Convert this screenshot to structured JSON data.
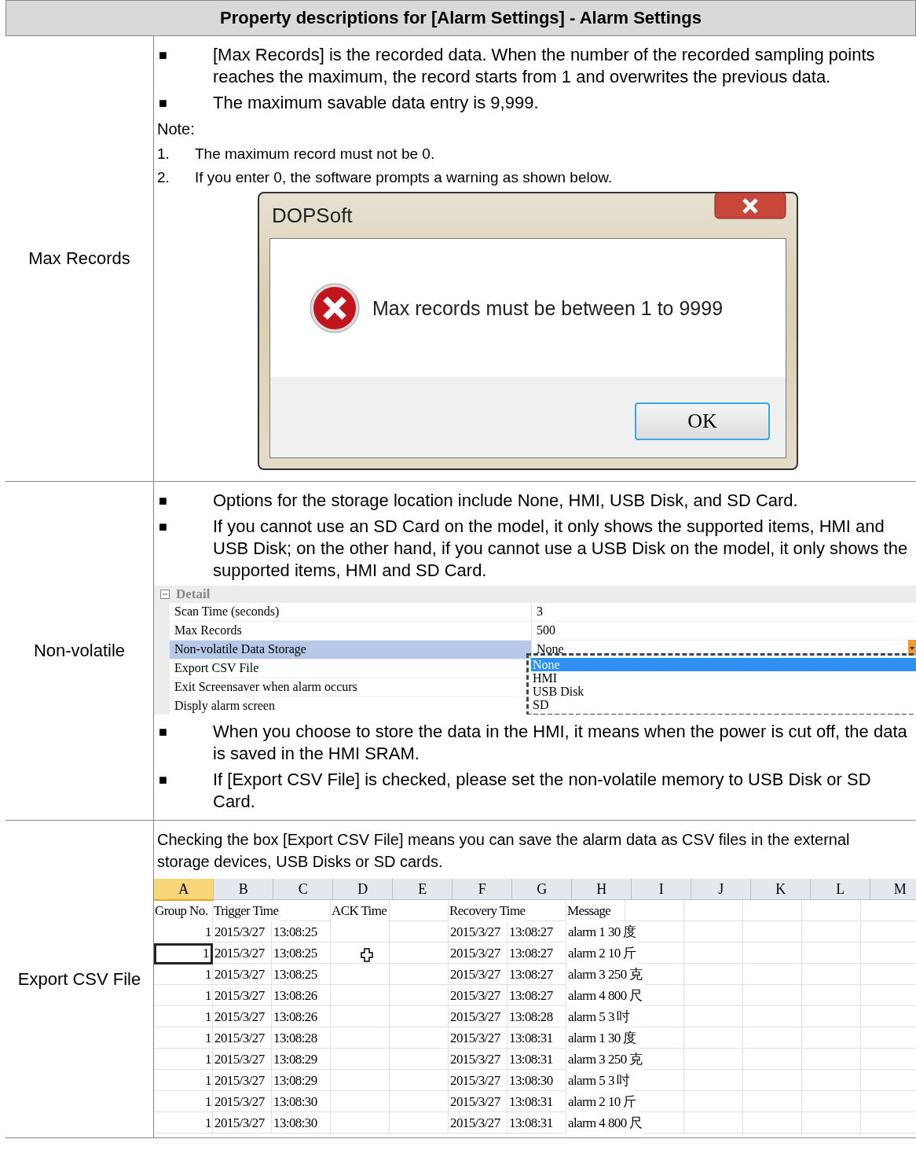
{
  "title": "Property descriptions for [Alarm Settings] - Alarm Settings",
  "sections": [
    {
      "label": "Max Records",
      "blocks": [
        {
          "kind": "bullet",
          "marker": "■",
          "text": "[Max Records] is the recorded data. When the number of the recorded sampling points reaches the maximum, the record starts from 1 and overwrites the previous data."
        },
        {
          "kind": "bullet",
          "marker": "■",
          "text": "The maximum savable data entry is 9,999."
        },
        {
          "kind": "para",
          "text": "Note:"
        },
        {
          "kind": "numbered",
          "marker": "1.",
          "text": "The maximum record must not be 0."
        },
        {
          "kind": "numbered",
          "marker": "2.",
          "text": "If you enter 0, the software prompts a warning as shown below."
        },
        {
          "kind": "dialog",
          "title": "DOPSoft",
          "message": "Max records must be between 1 to 9999",
          "button": "OK"
        }
      ]
    },
    {
      "label": "Non-volatile",
      "blocks": [
        {
          "kind": "bullet",
          "marker": "■",
          "text": "Options for the storage location include None, HMI, USB Disk, and SD Card."
        },
        {
          "kind": "bullet",
          "marker": "■",
          "text": "If you cannot use an SD Card on the model, it only shows the supported items, HMI and USB Disk; on the other hand, if you cannot use a USB Disk on the model, it only shows the supported items, HMI and SD Card."
        },
        {
          "kind": "propgrid",
          "group": "Detail",
          "expanded": true,
          "rows": [
            {
              "name": "Scan Time (seconds)",
              "value": "3",
              "selected": false
            },
            {
              "name": "Max Records",
              "value": "500",
              "selected": false
            },
            {
              "name": "Non-volatile Data Storage",
              "value": "None",
              "selected": true
            },
            {
              "name": "Export CSV File",
              "value": "",
              "selected": false
            },
            {
              "name": "Exit Screensaver when alarm occurs",
              "value": "",
              "selected": false
            },
            {
              "name": "Disply alarm screen",
              "value": "",
              "selected": false
            }
          ],
          "options": [
            {
              "label": "None",
              "selected": true
            },
            {
              "label": "HMI",
              "selected": false
            },
            {
              "label": "USB Disk",
              "selected": false
            },
            {
              "label": "SD",
              "selected": false
            }
          ]
        },
        {
          "kind": "bullet",
          "marker": "■",
          "text": "When you choose to store the data in the HMI, it means when the power is cut off, the data is saved in the HMI SRAM."
        },
        {
          "kind": "bullet",
          "marker": "■",
          "text": "If [Export CSV File] is checked, please set the non-volatile memory to USB Disk or SD Card."
        }
      ]
    },
    {
      "label": "Export CSV File",
      "blocks": [
        {
          "kind": "para",
          "text": "Checking the box [Export CSV File] means you can save the alarm data as CSV files in the external storage devices, USB Disks or SD cards."
        },
        {
          "kind": "sheet",
          "columns": [
            {
              "label": "A",
              "selected": true,
              "heading": "Group No."
            },
            {
              "label": "B",
              "selected": false,
              "heading": "Trigger Time"
            },
            {
              "label": "C",
              "selected": false
            },
            {
              "label": "D",
              "selected": false,
              "heading": "ACK Time"
            },
            {
              "label": "E",
              "selected": false
            },
            {
              "label": "F",
              "selected": false,
              "heading": "Recovery Time"
            },
            {
              "label": "G",
              "selected": false
            },
            {
              "label": "H",
              "selected": false,
              "heading": "Message"
            },
            {
              "label": "I",
              "selected": false
            },
            {
              "label": "J",
              "selected": false
            },
            {
              "label": "K",
              "selected": false
            },
            {
              "label": "L",
              "selected": false
            },
            {
              "label": "M",
              "selected": false
            }
          ],
          "rows": [
            {
              "selected": false,
              "cells": [
                "1",
                "2015/3/27",
                "13:08:25",
                "",
                "",
                "2015/3/27",
                "13:08:27",
                "alarm 1 30 度"
              ]
            },
            {
              "selected": true,
              "cells": [
                "1",
                "2015/3/27",
                "13:08:25",
                "",
                "",
                "2015/3/27",
                "13:08:27",
                "alarm 2 10 斤"
              ]
            },
            {
              "selected": false,
              "cells": [
                "1",
                "2015/3/27",
                "13:08:25",
                "",
                "",
                "2015/3/27",
                "13:08:27",
                "alarm 3 250 克"
              ]
            },
            {
              "selected": false,
              "cells": [
                "1",
                "2015/3/27",
                "13:08:26",
                "",
                "",
                "2015/3/27",
                "13:08:27",
                "alarm 4 800 尺"
              ]
            },
            {
              "selected": false,
              "cells": [
                "1",
                "2015/3/27",
                "13:08:26",
                "",
                "",
                "2015/3/27",
                "13:08:28",
                "alarm 5 3 吋"
              ]
            },
            {
              "selected": false,
              "cells": [
                "1",
                "2015/3/27",
                "13:08:28",
                "",
                "",
                "2015/3/27",
                "13:08:31",
                "alarm 1 30 度"
              ]
            },
            {
              "selected": false,
              "cells": [
                "1",
                "2015/3/27",
                "13:08:29",
                "",
                "",
                "2015/3/27",
                "13:08:31",
                "alarm 3 250 克"
              ]
            },
            {
              "selected": false,
              "cells": [
                "1",
                "2015/3/27",
                "13:08:29",
                "",
                "",
                "2015/3/27",
                "13:08:30",
                "alarm 5 3 吋"
              ]
            },
            {
              "selected": false,
              "cells": [
                "1",
                "2015/3/27",
                "13:08:30",
                "",
                "",
                "2015/3/27",
                "13:08:31",
                "alarm 2 10 斤"
              ]
            },
            {
              "selected": false,
              "cells": [
                "1",
                "2015/3/27",
                "13:08:30",
                "",
                "",
                "2015/3/27",
                "13:08:31",
                "alarm 4 800 尺"
              ]
            }
          ]
        }
      ]
    }
  ]
}
